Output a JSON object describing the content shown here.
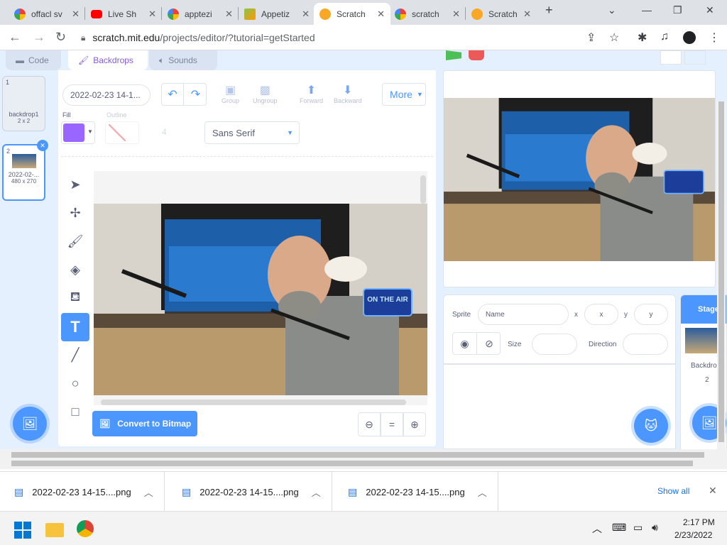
{
  "browser": {
    "tabs": [
      {
        "title": "offacl sv",
        "icon": "google-icon",
        "active": false
      },
      {
        "title": "Live Sh",
        "icon": "youtube-icon",
        "active": false
      },
      {
        "title": "apptezi",
        "icon": "google-icon",
        "active": false
      },
      {
        "title": "Appetiz",
        "icon": "box-icon",
        "active": false
      },
      {
        "title": "Scratch",
        "icon": "scratch-icon",
        "active": true
      },
      {
        "title": "scratch",
        "icon": "google-icon",
        "active": false
      },
      {
        "title": "Scratch",
        "icon": "scratch-icon",
        "active": false
      }
    ],
    "url_host": "scratch.mit.edu",
    "url_path": "/projects/editor/?tutorial=getStarted"
  },
  "editor": {
    "tabs": {
      "code": "Code",
      "backdrops": "Backdrops",
      "sounds": "Sounds"
    },
    "costumes": [
      {
        "num": "1",
        "name": "backdrop1",
        "size": "2 x 2"
      },
      {
        "num": "2",
        "name": "2022-02-...",
        "size": "480 x 270"
      }
    ],
    "paint": {
      "costume_name": "2022-02-23 14-1...",
      "fill_label": "Fill",
      "outline_label": "Outline",
      "outline_size": "4",
      "group": "Group",
      "ungroup": "Ungroup",
      "forward": "Forward",
      "backward": "Backward",
      "more": "More",
      "font": "Sans Serif",
      "fill_color": "#9966ff",
      "convert": "Convert to Bitmap",
      "on_air": "ON THE AIR"
    },
    "sprite": {
      "sprite_label": "Sprite",
      "name_placeholder": "Name",
      "x_label": "x",
      "x_placeholder": "x",
      "y_label": "y",
      "y_placeholder": "y",
      "show_label": "Show",
      "size_label": "Size",
      "direction_label": "Direction"
    },
    "stage_panel": {
      "title": "Stage",
      "backdrops_label": "Backdrops",
      "backdrops_count": "2"
    }
  },
  "downloads": {
    "items": [
      "2022-02-23 14-15....png",
      "2022-02-23 14-15....png",
      "2022-02-23 14-15....png"
    ],
    "show_all": "Show all"
  },
  "taskbar": {
    "time": "2:17 PM",
    "date": "2/23/2022"
  },
  "colors": {
    "accent": "#4c97ff",
    "purple": "#855cd6"
  }
}
